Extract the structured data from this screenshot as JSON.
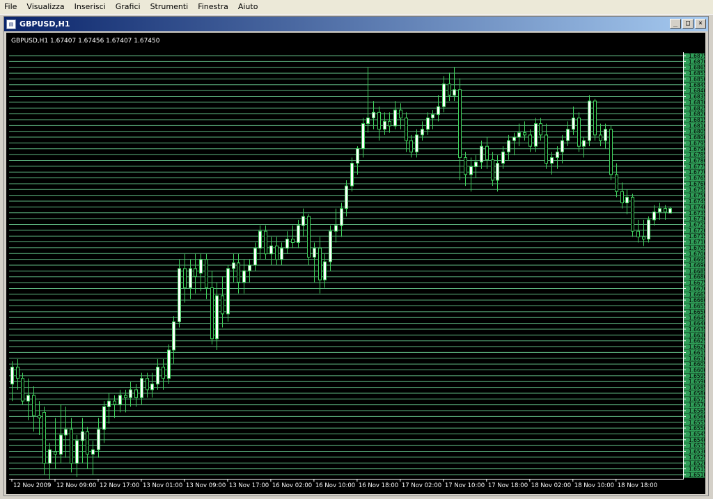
{
  "menu": [
    "File",
    "Visualizza",
    "Inserisci",
    "Grafici",
    "Strumenti",
    "Finestra",
    "Aiuto"
  ],
  "window": {
    "title": "GBPUSD,H1",
    "buttons": [
      "minimize",
      "maximize",
      "close"
    ]
  },
  "chart_data": {
    "type": "candlestick",
    "symbol_info": "GBPUSD,H1  1.67407 1.67456 1.67407 1.67450",
    "price_scale": [
      "1.68750",
      "1.68700",
      "1.68650",
      "1.68550",
      "1.68500",
      "1.68450",
      "1.68400",
      "1.68350",
      "1.68300",
      "1.68250",
      "1.68200",
      "1.68150",
      "1.68100",
      "1.68050",
      "1.68000",
      "1.67950",
      "1.67900",
      "1.67850",
      "1.67800",
      "1.67750",
      "1.67700",
      "1.67650",
      "1.67600",
      "1.67550",
      "1.67500",
      "1.67450",
      "1.67400",
      "1.67350",
      "1.67300",
      "1.67250",
      "1.67200",
      "1.67150",
      "1.67100",
      "1.67050",
      "1.67000",
      "1.66950",
      "1.66900",
      "1.66850",
      "1.66800",
      "1.66750",
      "1.66700",
      "1.66650",
      "1.66600",
      "1.66550",
      "1.66500",
      "1.66450",
      "1.66400",
      "1.66350",
      "1.66300",
      "1.66250",
      "1.66200",
      "1.66150",
      "1.66100",
      "1.66050",
      "1.66000",
      "1.65950",
      "1.65900",
      "1.65850",
      "1.65800",
      "1.65750",
      "1.65700",
      "1.65650",
      "1.65600",
      "1.65550",
      "1.65500",
      "1.65450",
      "1.65400",
      "1.65350",
      "1.65300",
      "1.65250",
      "1.65200",
      "1.65150",
      "1.65100"
    ],
    "time_labels": [
      "12 Nov 2009",
      "12 Nov 09:00",
      "12 Nov 17:00",
      "13 Nov 01:00",
      "13 Nov 09:00",
      "13 Nov 17:00",
      "16 Nov 02:00",
      "16 Nov 10:00",
      "16 Nov 18:00",
      "17 Nov 02:00",
      "17 Nov 10:00",
      "17 Nov 18:00",
      "18 Nov 02:00",
      "18 Nov 10:00",
      "18 Nov 18:00"
    ],
    "ylim": [
      1.651,
      1.688
    ],
    "grid": true,
    "candles": [
      [
        1.659,
        1.661,
        1.6575,
        1.6605
      ],
      [
        1.6605,
        1.6612,
        1.6585,
        1.6595
      ],
      [
        1.6595,
        1.66,
        1.6572,
        1.6575
      ],
      [
        1.6575,
        1.6595,
        1.6558,
        1.658
      ],
      [
        1.658,
        1.6588,
        1.6548,
        1.6562
      ],
      [
        1.6562,
        1.6575,
        1.6545,
        1.656
      ],
      [
        1.6565,
        1.657,
        1.651,
        1.652
      ],
      [
        1.652,
        1.6538,
        1.6505,
        1.6532
      ],
      [
        1.653,
        1.656,
        1.6515,
        1.6528
      ],
      [
        1.6528,
        1.6572,
        1.652,
        1.6545
      ],
      [
        1.6545,
        1.657,
        1.6525,
        1.655
      ],
      [
        1.655,
        1.656,
        1.6512,
        1.652
      ],
      [
        1.652,
        1.6545,
        1.6508,
        1.654
      ],
      [
        1.654,
        1.656,
        1.652,
        1.6548
      ],
      [
        1.6548,
        1.6552,
        1.6515,
        1.6528
      ],
      [
        1.6528,
        1.654,
        1.651,
        1.6532
      ],
      [
        1.6532,
        1.656,
        1.6525,
        1.655
      ],
      [
        1.655,
        1.6575,
        1.6538,
        1.657
      ],
      [
        1.657,
        1.6582,
        1.6555,
        1.6575
      ],
      [
        1.6575,
        1.658,
        1.656,
        1.6572
      ],
      [
        1.6572,
        1.6585,
        1.6565,
        1.658
      ],
      [
        1.658,
        1.6585,
        1.6565,
        1.6578
      ],
      [
        1.6578,
        1.6592,
        1.657,
        1.6585
      ],
      [
        1.6585,
        1.659,
        1.657,
        1.6578
      ],
      [
        1.6578,
        1.66,
        1.6572,
        1.6595
      ],
      [
        1.6595,
        1.66,
        1.6578,
        1.6585
      ],
      [
        1.6585,
        1.66,
        1.6578,
        1.659
      ],
      [
        1.659,
        1.6612,
        1.6585,
        1.6605
      ],
      [
        1.6605,
        1.6612,
        1.6585,
        1.6595
      ],
      [
        1.6595,
        1.6625,
        1.659,
        1.662
      ],
      [
        1.662,
        1.665,
        1.6608,
        1.6645
      ],
      [
        1.6645,
        1.67,
        1.664,
        1.6692
      ],
      [
        1.6692,
        1.6705,
        1.6662,
        1.6675
      ],
      [
        1.6675,
        1.67,
        1.6665,
        1.6692
      ],
      [
        1.6692,
        1.6705,
        1.667,
        1.6685
      ],
      [
        1.6688,
        1.6705,
        1.6672,
        1.67
      ],
      [
        1.67,
        1.6705,
        1.6665,
        1.6675
      ],
      [
        1.6675,
        1.669,
        1.6625,
        1.663
      ],
      [
        1.663,
        1.668,
        1.662,
        1.6668
      ],
      [
        1.6668,
        1.6685,
        1.664,
        1.6652
      ],
      [
        1.6652,
        1.6695,
        1.6645,
        1.6692
      ],
      [
        1.6692,
        1.6705,
        1.668,
        1.6697
      ],
      [
        1.6697,
        1.6705,
        1.667,
        1.668
      ],
      [
        1.668,
        1.67,
        1.667,
        1.669
      ],
      [
        1.669,
        1.67,
        1.668,
        1.6695
      ],
      [
        1.6695,
        1.6715,
        1.669,
        1.671
      ],
      [
        1.671,
        1.673,
        1.67,
        1.6725
      ],
      [
        1.6725,
        1.673,
        1.67,
        1.6705
      ],
      [
        1.6705,
        1.672,
        1.6695,
        1.6712
      ],
      [
        1.6712,
        1.672,
        1.6695,
        1.67
      ],
      [
        1.67,
        1.6715,
        1.6695,
        1.671
      ],
      [
        1.671,
        1.6725,
        1.6705,
        1.6718
      ],
      [
        1.6718,
        1.673,
        1.671,
        1.6715
      ],
      [
        1.6715,
        1.6735,
        1.671,
        1.673
      ],
      [
        1.673,
        1.6745,
        1.672,
        1.6738
      ],
      [
        1.6738,
        1.674,
        1.6695,
        1.6702
      ],
      [
        1.6702,
        1.6715,
        1.668,
        1.671
      ],
      [
        1.671,
        1.672,
        1.667,
        1.6682
      ],
      [
        1.6682,
        1.6705,
        1.6675,
        1.6698
      ],
      [
        1.6698,
        1.673,
        1.669,
        1.6725
      ],
      [
        1.6725,
        1.6745,
        1.6715,
        1.673
      ],
      [
        1.673,
        1.675,
        1.672,
        1.6745
      ],
      [
        1.6745,
        1.677,
        1.6738,
        1.6765
      ],
      [
        1.6765,
        1.679,
        1.676,
        1.6785
      ],
      [
        1.6785,
        1.68,
        1.6775,
        1.6798
      ],
      [
        1.6798,
        1.6825,
        1.679,
        1.682
      ],
      [
        1.682,
        1.687,
        1.6812,
        1.6825
      ],
      [
        1.6825,
        1.684,
        1.6815,
        1.683
      ],
      [
        1.683,
        1.6835,
        1.6805,
        1.6815
      ],
      [
        1.6815,
        1.683,
        1.681,
        1.6822
      ],
      [
        1.6822,
        1.683,
        1.6812,
        1.6818
      ],
      [
        1.6818,
        1.684,
        1.6815,
        1.6832
      ],
      [
        1.6832,
        1.6838,
        1.6815,
        1.6825
      ],
      [
        1.6825,
        1.683,
        1.6795,
        1.6805
      ],
      [
        1.6805,
        1.681,
        1.679,
        1.6795
      ],
      [
        1.6795,
        1.6815,
        1.679,
        1.681
      ],
      [
        1.681,
        1.6822,
        1.6805,
        1.6815
      ],
      [
        1.6815,
        1.683,
        1.681,
        1.6825
      ],
      [
        1.6825,
        1.6832,
        1.6815,
        1.6828
      ],
      [
        1.6828,
        1.6845,
        1.6822,
        1.6835
      ],
      [
        1.6835,
        1.6862,
        1.683,
        1.6855
      ],
      [
        1.6855,
        1.6865,
        1.684,
        1.6845
      ],
      [
        1.6845,
        1.687,
        1.684,
        1.685
      ],
      [
        1.685,
        1.686,
        1.677,
        1.679
      ],
      [
        1.679,
        1.6795,
        1.6765,
        1.6775
      ],
      [
        1.6775,
        1.679,
        1.676,
        1.6782
      ],
      [
        1.6782,
        1.6792,
        1.6772,
        1.6786
      ],
      [
        1.6786,
        1.6805,
        1.678,
        1.68
      ],
      [
        1.68,
        1.6808,
        1.678,
        1.6788
      ],
      [
        1.6788,
        1.6795,
        1.6765,
        1.677
      ],
      [
        1.677,
        1.6792,
        1.676,
        1.6785
      ],
      [
        1.6785,
        1.68,
        1.678,
        1.6795
      ],
      [
        1.6795,
        1.681,
        1.6788,
        1.6805
      ],
      [
        1.6805,
        1.6812,
        1.6792,
        1.6808
      ],
      [
        1.6808,
        1.682,
        1.68,
        1.6812
      ],
      [
        1.6812,
        1.6822,
        1.6805,
        1.681
      ],
      [
        1.681,
        1.6815,
        1.6795,
        1.68
      ],
      [
        1.68,
        1.6825,
        1.6795,
        1.682
      ],
      [
        1.682,
        1.6825,
        1.6805,
        1.681
      ],
      [
        1.681,
        1.682,
        1.678,
        1.6785
      ],
      [
        1.6785,
        1.6795,
        1.6775,
        1.679
      ],
      [
        1.679,
        1.68,
        1.678,
        1.6795
      ],
      [
        1.6795,
        1.681,
        1.6785,
        1.6805
      ],
      [
        1.6805,
        1.6822,
        1.68,
        1.6815
      ],
      [
        1.6815,
        1.6835,
        1.681,
        1.6825
      ],
      [
        1.6825,
        1.683,
        1.6795,
        1.68
      ],
      [
        1.68,
        1.6808,
        1.679,
        1.6805
      ],
      [
        1.6805,
        1.6845,
        1.68,
        1.684
      ],
      [
        1.684,
        1.6842,
        1.6805,
        1.681
      ],
      [
        1.681,
        1.682,
        1.68,
        1.6805
      ],
      [
        1.6805,
        1.682,
        1.6798,
        1.6815
      ],
      [
        1.6815,
        1.6818,
        1.677,
        1.6775
      ],
      [
        1.6775,
        1.6785,
        1.6755,
        1.676
      ],
      [
        1.676,
        1.6768,
        1.6745,
        1.675
      ],
      [
        1.675,
        1.6762,
        1.674,
        1.6755
      ],
      [
        1.6755,
        1.6758,
        1.672,
        1.6725
      ],
      [
        1.6725,
        1.6735,
        1.6715,
        1.672
      ],
      [
        1.672,
        1.6735,
        1.6712,
        1.6718
      ],
      [
        1.6718,
        1.6738,
        1.6715,
        1.6735
      ],
      [
        1.6735,
        1.6748,
        1.673,
        1.6742
      ],
      [
        1.6742,
        1.675,
        1.6735,
        1.6745
      ],
      [
        1.6745,
        1.6748,
        1.6735,
        1.6742
      ],
      [
        1.6741,
        1.6746,
        1.6741,
        1.6745
      ]
    ]
  }
}
